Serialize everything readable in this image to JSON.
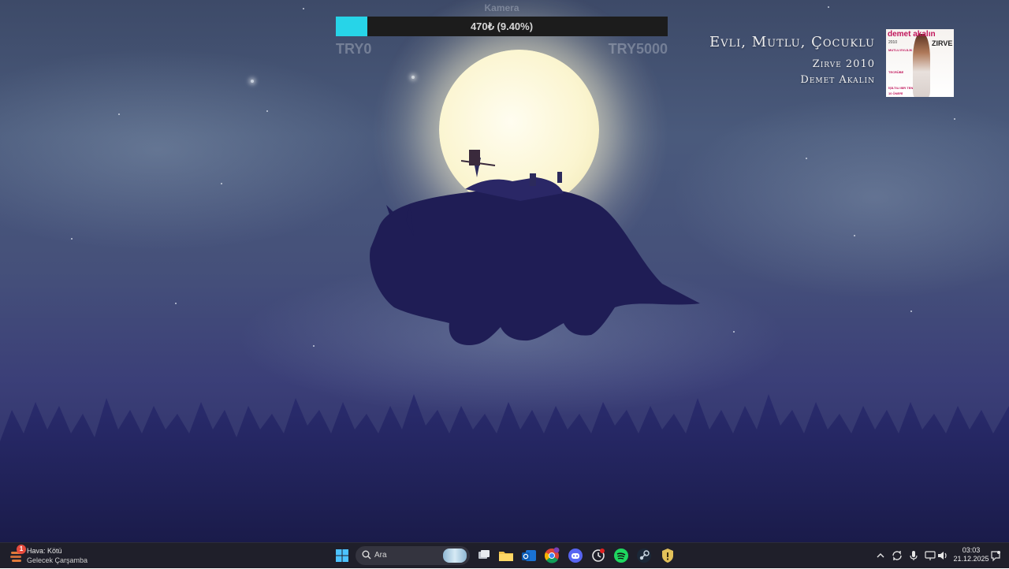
{
  "progress": {
    "caption": "Kamera",
    "value_text": "470₺ (9.40%)",
    "fraction": 0.094,
    "min_label": "TRY0",
    "max_label": "TRY5000",
    "fill_color": "#27d4e8"
  },
  "music": {
    "title": "Evli, Mutlu, Çocuklu",
    "album": "Zirve 2010",
    "artist": "Demet Akalın",
    "cover": {
      "brand": "demet akalın",
      "year": "2010",
      "headline": "ZIRVE",
      "lines": [
        "MUTLU EVLİLİK",
        "TECRÜBE",
        "İŞİLTILI BİR TEN",
        "10 ÖNERİ"
      ]
    }
  },
  "taskbar": {
    "weather": {
      "icon": "weather-icon",
      "badge": "1",
      "title": "Hava: Kötü",
      "subtitle": "Gelecek Çarşamba"
    },
    "search": {
      "label": "Ara"
    },
    "apps": [
      {
        "name": "start-button",
        "icon": "windows-logo-icon"
      },
      {
        "name": "task-view-button",
        "icon": "task-view-icon"
      },
      {
        "name": "file-explorer-button",
        "icon": "folder-icon"
      },
      {
        "name": "outlook-button",
        "icon": "outlook-icon"
      },
      {
        "name": "chrome-button",
        "icon": "chrome-icon"
      },
      {
        "name": "discord-button",
        "icon": "discord-icon"
      },
      {
        "name": "sync-app-button",
        "icon": "sync-icon"
      },
      {
        "name": "spotify-button",
        "icon": "spotify-icon"
      },
      {
        "name": "steam-button",
        "icon": "steam-icon"
      },
      {
        "name": "security-app-button",
        "icon": "shield-icon"
      }
    ],
    "tray": {
      "time": "03:03",
      "date": "21.12.2025",
      "icons": [
        "chevron-up-icon",
        "refresh-icon",
        "microphone-icon",
        "network-icon",
        "volume-icon",
        "notification-icon"
      ]
    }
  }
}
